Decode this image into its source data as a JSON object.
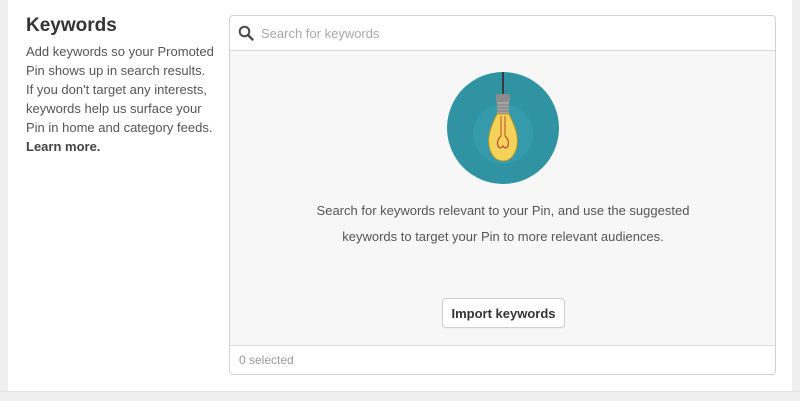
{
  "section": {
    "title": "Keywords",
    "description": "Add keywords so your Promoted Pin shows up in search results. If you don't target any interests, keywords help us surface your Pin in home and category feeds.",
    "learn_more": "Learn more."
  },
  "search": {
    "icon": "search-icon",
    "placeholder": "Search for keywords",
    "value": ""
  },
  "empty_state": {
    "illustration": "lightbulb-icon",
    "message": "Search for keywords relevant to your Pin, and use the suggested keywords to target your Pin to more relevant audiences.",
    "import_button": "Import keywords"
  },
  "footer": {
    "selected_text": "0 selected"
  },
  "colors": {
    "illustration_bg": "#2f93a4",
    "bulb": "#f3d35a"
  }
}
